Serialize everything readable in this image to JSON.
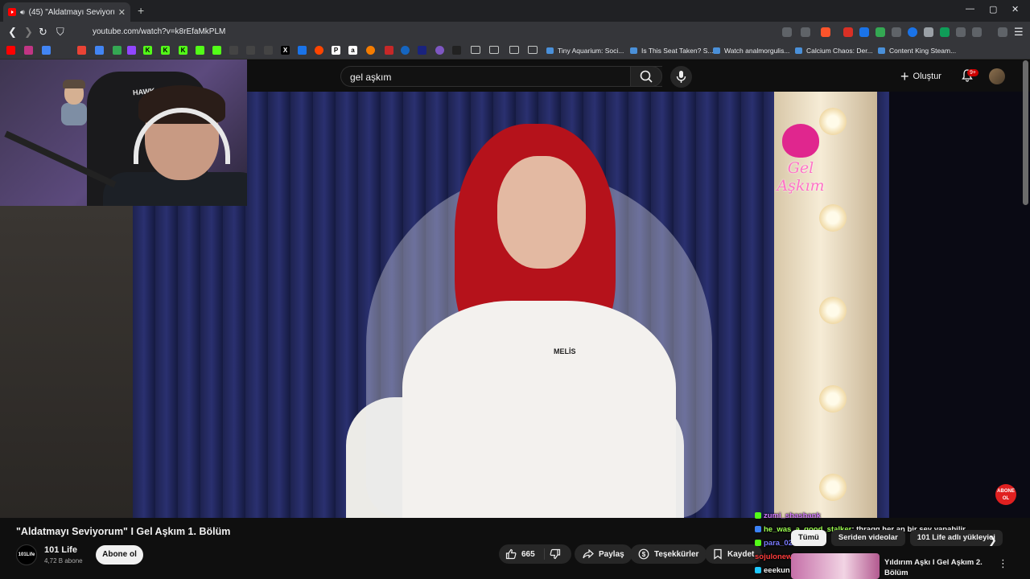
{
  "browser": {
    "tab_title": "(45) \"Aldatmayı Seviyorum\" I",
    "tab_close": "✕",
    "new_tab": "+",
    "url": "youtube.com/watch?v=k8rEfaMkPLM",
    "window_controls": [
      "—",
      "▢",
      "✕"
    ],
    "bookmarks": [
      "Tiny Aquarium: Soci...",
      "Is This Seat Taken? S...",
      "Watch analmorgulis...",
      "Calcium Chaos: Der...",
      "Content King Steam..."
    ],
    "bookmark_icon_letters": [
      "K",
      "K",
      "K",
      "P",
      "a"
    ]
  },
  "masthead": {
    "search_value": "gel aşkım",
    "create_label": "Oluştur",
    "notification_count": "9+"
  },
  "video": {
    "logo_text": "Gel Aşkım",
    "name_tag": "MELİS",
    "subscribe_watermark": "ABONE OL",
    "webcam_chair_text": "HAWK"
  },
  "info": {
    "title": "\"Aldatmayı Seviyorum\" I Gel Aşkım 1. Bölüm",
    "channel_name": "101 Life",
    "channel_avatar_text": "101Life",
    "subscribers": "4,72 B abone",
    "subscribe_label": "Abone ol",
    "like_count": "665",
    "share_label": "Paylaş",
    "thanks_label": "Teşekkürler",
    "save_label": "Kaydet"
  },
  "chat": [
    {
      "user": "zumi_shashank",
      "message": "",
      "color": "#d67cff"
    },
    {
      "user": "he_was_a_good_stalker",
      "message": ": thragg her an bir şey yapabilir",
      "color": "#9cff4f"
    },
    {
      "user": "para_02",
      "message": "",
      "color": "#7a7aff"
    },
    {
      "user": "sojulonewolf",
      "message": "",
      "color": "#ff3c3c"
    },
    {
      "user": "eeekun",
      "message": ": amk",
      "color": "#f1f1f1"
    }
  ],
  "chips": [
    "Tümü",
    "Seriden videolar",
    "101 Life adlı yükleyici"
  ],
  "recommendation": {
    "title": "Yıldırım Aşkı I Gel Aşkım 2. Bölüm",
    "more": "⋮"
  },
  "colors": {
    "youtube_red": "#ff0000",
    "background": "#0f0f0f",
    "chip_active": "#f1f1f1"
  }
}
